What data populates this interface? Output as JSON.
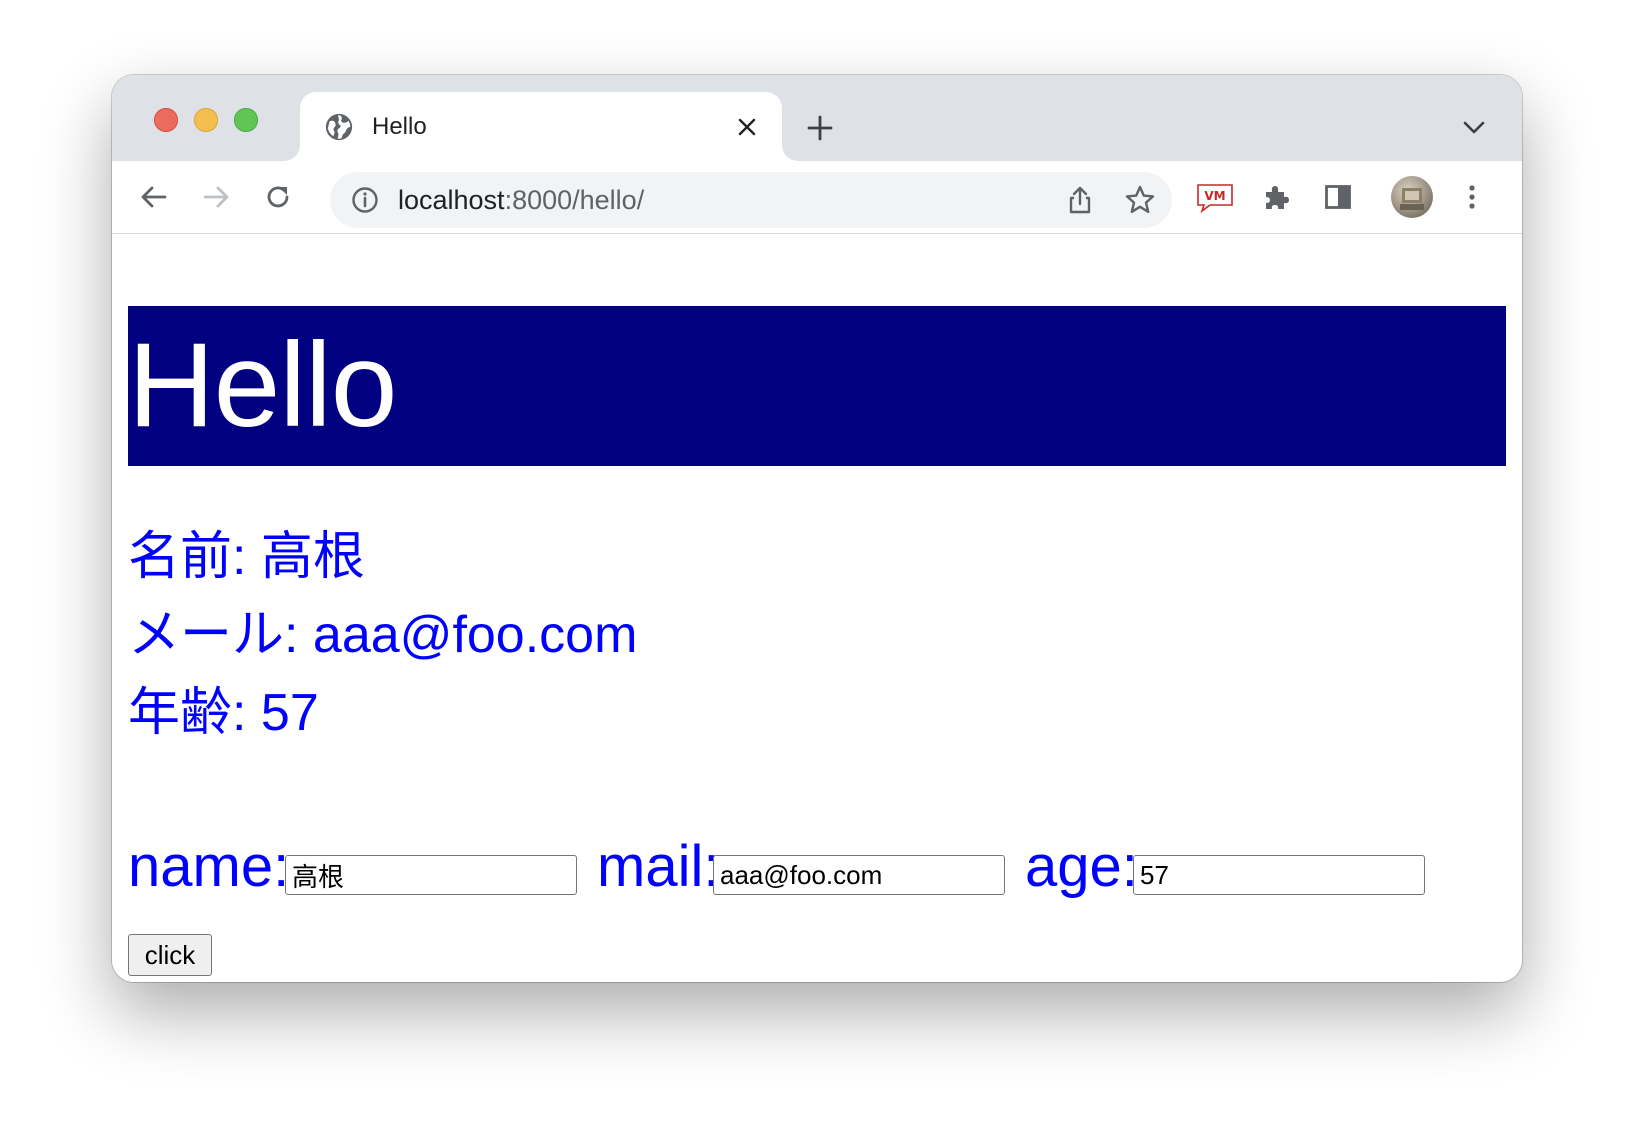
{
  "browser": {
    "tab": {
      "title": "Hello",
      "favicon": "globe-icon"
    },
    "address_bar": {
      "host": "localhost",
      "rest": ":8000/hello/"
    },
    "icons": {
      "back": "arrow-left-icon",
      "forward": "arrow-right-icon",
      "reload": "reload-icon",
      "info": "info-icon",
      "share": "share-icon",
      "bookmark": "star-icon",
      "extension_vm": "vm-extension-icon",
      "extensions": "puzzle-icon",
      "side_panel": "side-panel-icon",
      "menu": "kebab-menu-icon",
      "new_tab": "plus-icon",
      "tab_search": "chevron-down-icon",
      "close_tab": "close-icon"
    },
    "colors": {
      "tabbar_bg": "#dee1e6",
      "close_red": "#ed6a5e",
      "minimize_yellow": "#f5bf4f",
      "maximize_green": "#61c554"
    }
  },
  "page": {
    "heading": "Hello",
    "heading_bg": "#000080",
    "text_color": "#0000ff",
    "info": {
      "name_line": "名前: 高根",
      "mail_line": "メール: aaa@foo.com",
      "age_line": "年齢: 57"
    },
    "form": {
      "name_label": "name:",
      "name_value": "高根",
      "mail_label": "mail:",
      "mail_value": "aaa@foo.com",
      "age_label": "age:",
      "age_value": "57",
      "submit_label": "click"
    }
  }
}
